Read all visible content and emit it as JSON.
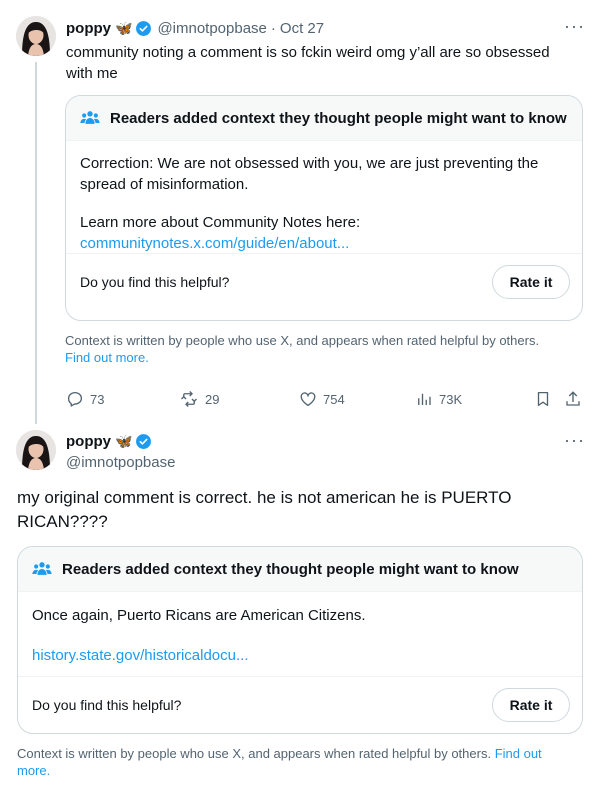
{
  "tweet1": {
    "name": "poppy",
    "emoji": "🦋",
    "handle": "@imnotpopbase",
    "dot": "·",
    "date": "Oct 27",
    "text": "community noting a comment is so fckin weird omg y’all are so obsessed with me",
    "note": {
      "header": "Readers added context they thought people might want to know",
      "body": "Correction: We are not obsessed with you, we are just preventing the spread of misinformation.",
      "learn_more": "Learn more about Community Notes here:",
      "link": "communitynotes.x.com/guide/en/about...",
      "helpful": "Do you find this helpful?",
      "rate": "Rate it"
    },
    "context_text": "Context is written by people who use X, and appears when rated helpful by others.",
    "find_out_more": "Find out more.",
    "metrics": {
      "replies": "73",
      "reposts": "29",
      "likes": "754",
      "views": "73K"
    }
  },
  "tweet2": {
    "name": "poppy",
    "emoji": "🦋",
    "handle": "@imnotpopbase",
    "text": "my original comment is correct. he is not american he is PUERTO RICAN????",
    "note": {
      "header": "Readers added context they thought people might want to know",
      "body": "Once again, Puerto Ricans are American Citizens.",
      "link": "history.state.gov/historicaldocu...",
      "helpful": "Do you find this helpful?",
      "rate": "Rate it"
    },
    "context_text": "Context is written by people who use X, and appears when rated helpful by others.",
    "find_out_more": "Find out more."
  },
  "colors": {
    "accent": "#1d9bf0",
    "verified": "#1d9bf0",
    "text": "#0f1419",
    "muted": "#536471"
  },
  "icons": [
    "people-icon",
    "verified-badge-icon",
    "more-icon",
    "reply-icon",
    "repost-icon",
    "like-icon",
    "views-icon",
    "bookmark-icon",
    "share-icon"
  ]
}
